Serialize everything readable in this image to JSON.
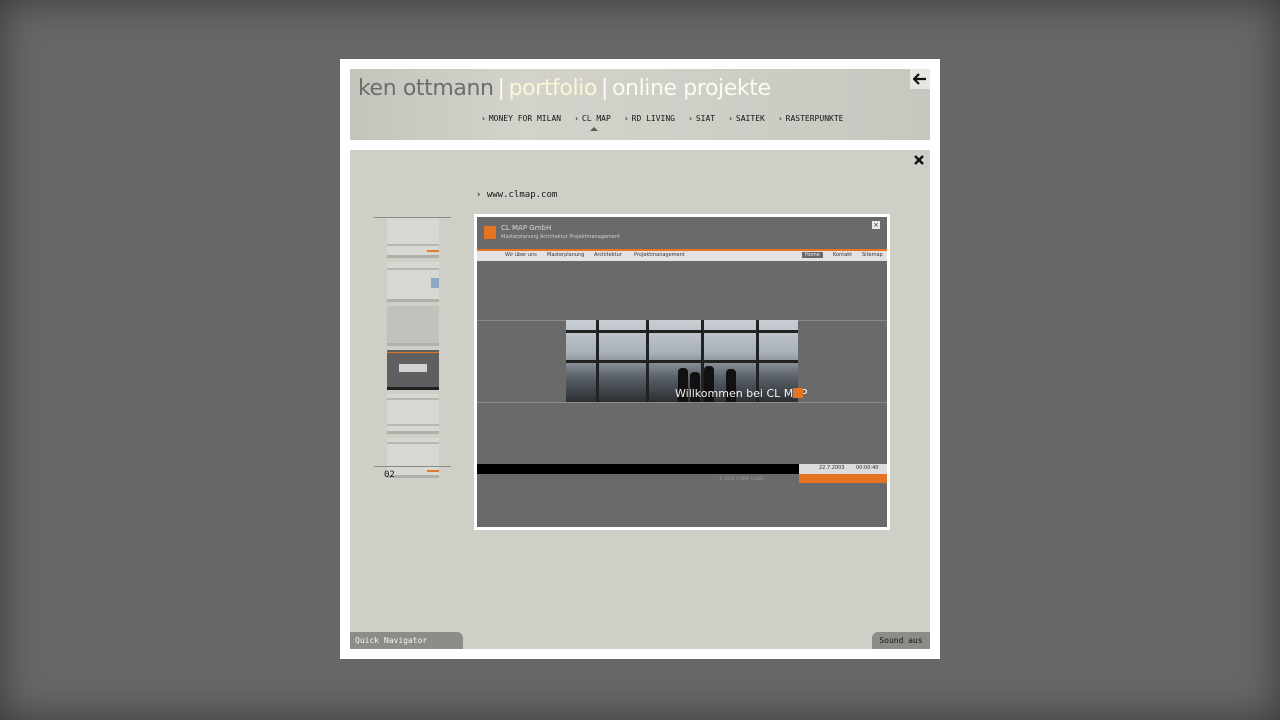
{
  "header": {
    "title_part1": "ken ottmann",
    "separator": "|",
    "title_part2": "portfolio",
    "title_part3": "online projekte"
  },
  "nav": {
    "items": [
      {
        "label": "MONEY FOR MILAN"
      },
      {
        "label": "CL MAP",
        "active": true
      },
      {
        "label": "RD LIVING"
      },
      {
        "label": "SIAT"
      },
      {
        "label": "SAITEK"
      },
      {
        "label": "RASTERPUNKTE"
      }
    ]
  },
  "content": {
    "link": "www.clmap.com",
    "page_number": "02"
  },
  "preview": {
    "brand": "CL MAP GmbH",
    "subtitle": "Masterplanung Architektur Projektmanagement",
    "menu": [
      "Wir über uns",
      "Masterplanung",
      "Architektur",
      "Projektmanagement"
    ],
    "menu_right": [
      "Home",
      "Kontakt",
      "Sitemap"
    ],
    "welcome": "Willkommen bei CL MAP",
    "footer_date": "22.7.2003",
    "footer_time": "00:00:40",
    "copyright": "© 2003 CLMAP GmbH"
  },
  "footer": {
    "quick_navigator": "Quick Navigator",
    "sound": "Sound aus"
  },
  "colors": {
    "background": "#676767",
    "panel": "#cfcec7",
    "accent_orange": "#e67322"
  },
  "icons": {
    "back": "arrow-left-icon",
    "close": "close-icon"
  }
}
